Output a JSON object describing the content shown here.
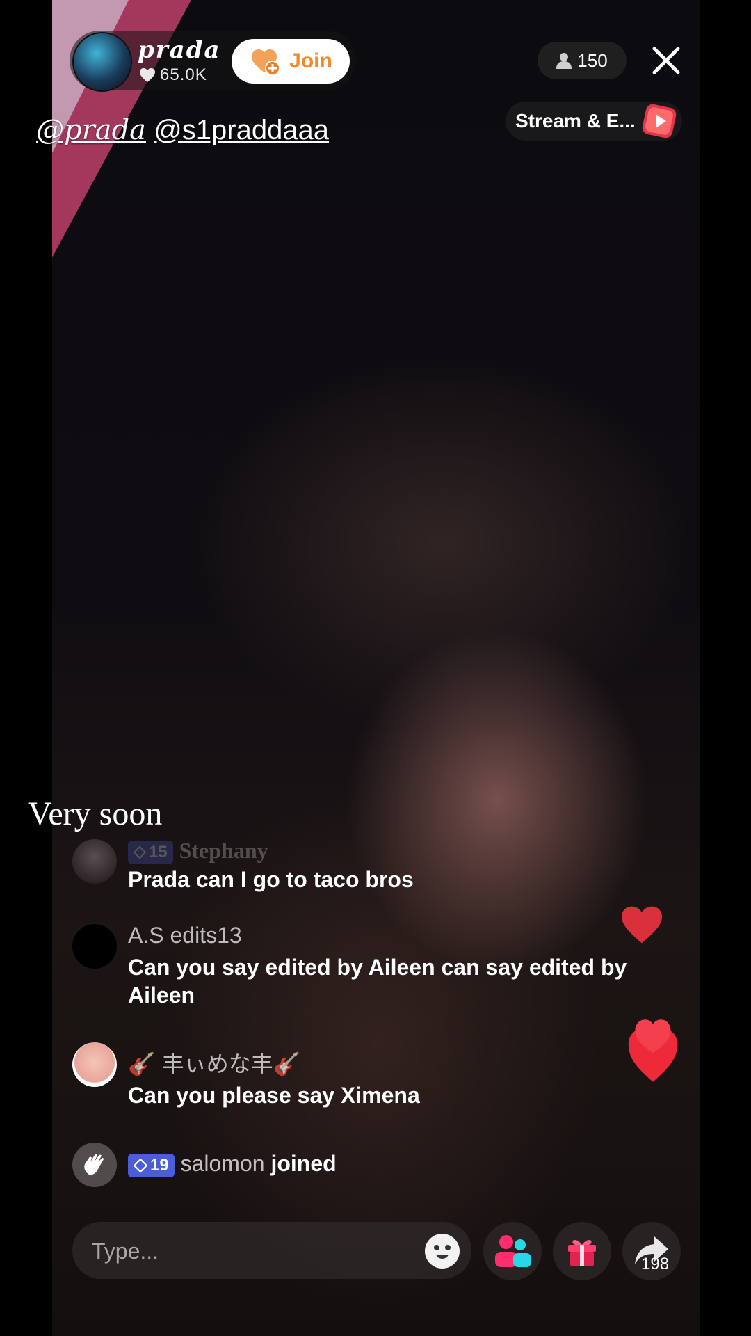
{
  "host": {
    "name": "prada",
    "likes": "65.0K",
    "join_label": "Join"
  },
  "viewer_count": "150",
  "stream_promo": {
    "label": "Stream & E..."
  },
  "tags": {
    "primary": "@prada",
    "secondary": "@s1praddaaa"
  },
  "caption": "Very soon",
  "comments": [
    {
      "user": "Stephany",
      "badge": "15",
      "text": "Prada can I go to taco bros"
    },
    {
      "user": "A.S edits13",
      "text": "Can you say edited by Aileen can say edited by Aileen"
    },
    {
      "user": "🎸 丰ぃめな丰🎸",
      "text": "Can you please say Ximena"
    }
  ],
  "join_event": {
    "badge": "19",
    "user": "salomon",
    "action": "joined"
  },
  "input": {
    "placeholder": "Type..."
  },
  "share_count": "198",
  "colors": {
    "join_accent": "#f18a2a",
    "heart": "#e8333f",
    "badge_bg": "#4b5ed6",
    "gift": "#ff3d6e",
    "people": "#ff2d6d"
  }
}
